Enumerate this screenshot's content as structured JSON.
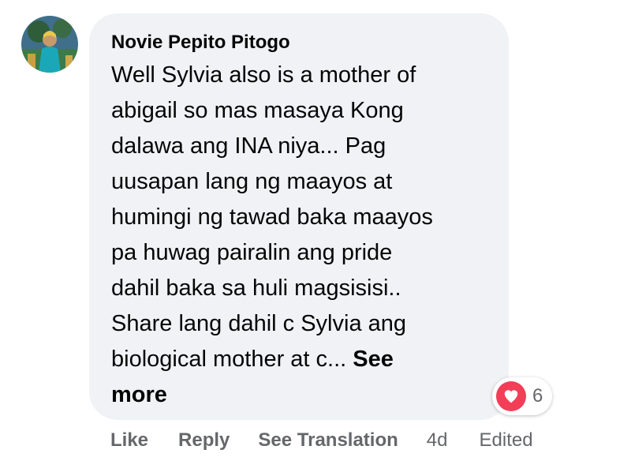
{
  "comment": {
    "author": "Novie Pepito Pitogo",
    "body_lines": [
      "Well Sylvia also is a mother of",
      "abigail so mas masaya Kong",
      "dalawa ang INA niya... Pag",
      "uusapan lang ng maayos at",
      "humingi ng tawad baka maayos",
      "pa huwag pairalin ang pride",
      "dahil baka sa huli magsisisi..",
      "Share lang dahil c Sylvia ang",
      "biological mother at c..."
    ],
    "see_more_label_part1": "See",
    "see_more_label_part2": "more",
    "reaction": {
      "icon": "heart-icon",
      "color": "#f33e58",
      "count": "6"
    },
    "actions": {
      "like": "Like",
      "reply": "Reply",
      "see_translation": "See Translation",
      "timestamp": "4d",
      "edited": "Edited"
    }
  }
}
